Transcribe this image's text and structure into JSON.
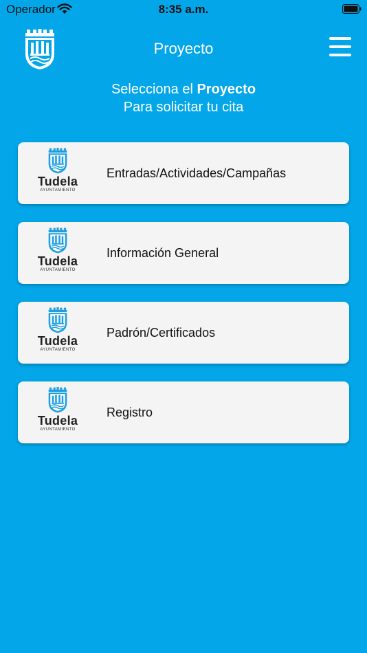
{
  "status_bar": {
    "carrier": "Operador",
    "time": "8:35 a.m."
  },
  "header": {
    "title": "Proyecto",
    "logo_icon": "crest-icon",
    "menu_icon": "hamburger-menu-icon"
  },
  "subtitle": {
    "prefix": "Selecciona el ",
    "emphasis": "Proyecto",
    "line2": "Para solicitar tu cita"
  },
  "brand": {
    "name": "Tudela",
    "sub": "AYUNTAMIENTO"
  },
  "projects": [
    {
      "label": "Entradas/Actividades/Campañas"
    },
    {
      "label": "Información General"
    },
    {
      "label": "Padrón/Certificados"
    },
    {
      "label": "Registro"
    }
  ],
  "colors": {
    "background": "#03a6e8",
    "card": "#f4f4f4",
    "crest_blue": "#1b9ee0"
  }
}
